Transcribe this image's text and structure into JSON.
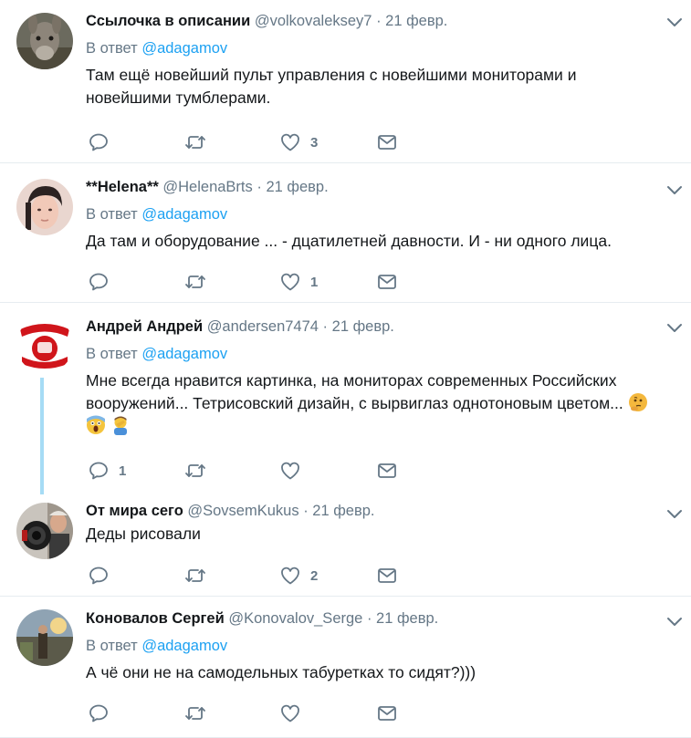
{
  "tweets": [
    {
      "name": "Ссылочка в описании",
      "handle": "@volkovaleksey7",
      "separator": "·",
      "time": "21 февр.",
      "reply_prefix": "В ответ",
      "reply_to": "@adagamov",
      "text": "Там ещё новейший пульт управления с новейшими мониторами и новейшими тумблерами.",
      "replies": "",
      "retweets": "",
      "likes": "3",
      "avatar_icon": "donkey-photo-avatar"
    },
    {
      "name": "**Helena**",
      "handle": "@HelenaBrts",
      "separator": "·",
      "time": "21 февр.",
      "reply_prefix": "В ответ",
      "reply_to": "@adagamov",
      "text": "Да там и оборудование ... - дцатилетней давности. И - ни одного лица.",
      "replies": "",
      "retweets": "",
      "likes": "1",
      "avatar_icon": "woman-photo-avatar"
    },
    {
      "name": "Андрей Андрей",
      "handle": "@andersen7474",
      "separator": "·",
      "time": "21 февр.",
      "reply_prefix": "В ответ",
      "reply_to": "@adagamov",
      "text": "Мне всегда нравится картинка, на мониторах современных Российских вооружений... Тетрисовский дизайн, с вырвиглаз однотоновым цветом...",
      "emojis": [
        "thinking-face-emoji",
        "screaming-face-emoji",
        "man-facepalming-emoji"
      ],
      "replies": "1",
      "retweets": "",
      "likes": "",
      "avatar_icon": "revolution-fist-avatar"
    },
    {
      "name": "От мира сего",
      "handle": "@SovsemKukus",
      "separator": "·",
      "time": "21 февр.",
      "text": "Деды рисовали",
      "replies": "",
      "retweets": "",
      "likes": "2",
      "avatar_icon": "man-with-camera-avatar"
    },
    {
      "name": "Коновалов Сергей",
      "handle": "@Konovalov_Serge",
      "separator": "·",
      "time": "21 февр.",
      "reply_prefix": "В ответ",
      "reply_to": "@adagamov",
      "text": "А чё они не на самодельных табуретках то сидят?)))",
      "replies": "",
      "retweets": "",
      "likes": "",
      "avatar_icon": "outdoor-photo-avatar"
    }
  ],
  "colors": {
    "link": "#1da1f2",
    "secondary_text": "#657786",
    "primary_text": "#14171a",
    "divider": "#e6ecf0",
    "thread_line": "#a6dcf5"
  }
}
